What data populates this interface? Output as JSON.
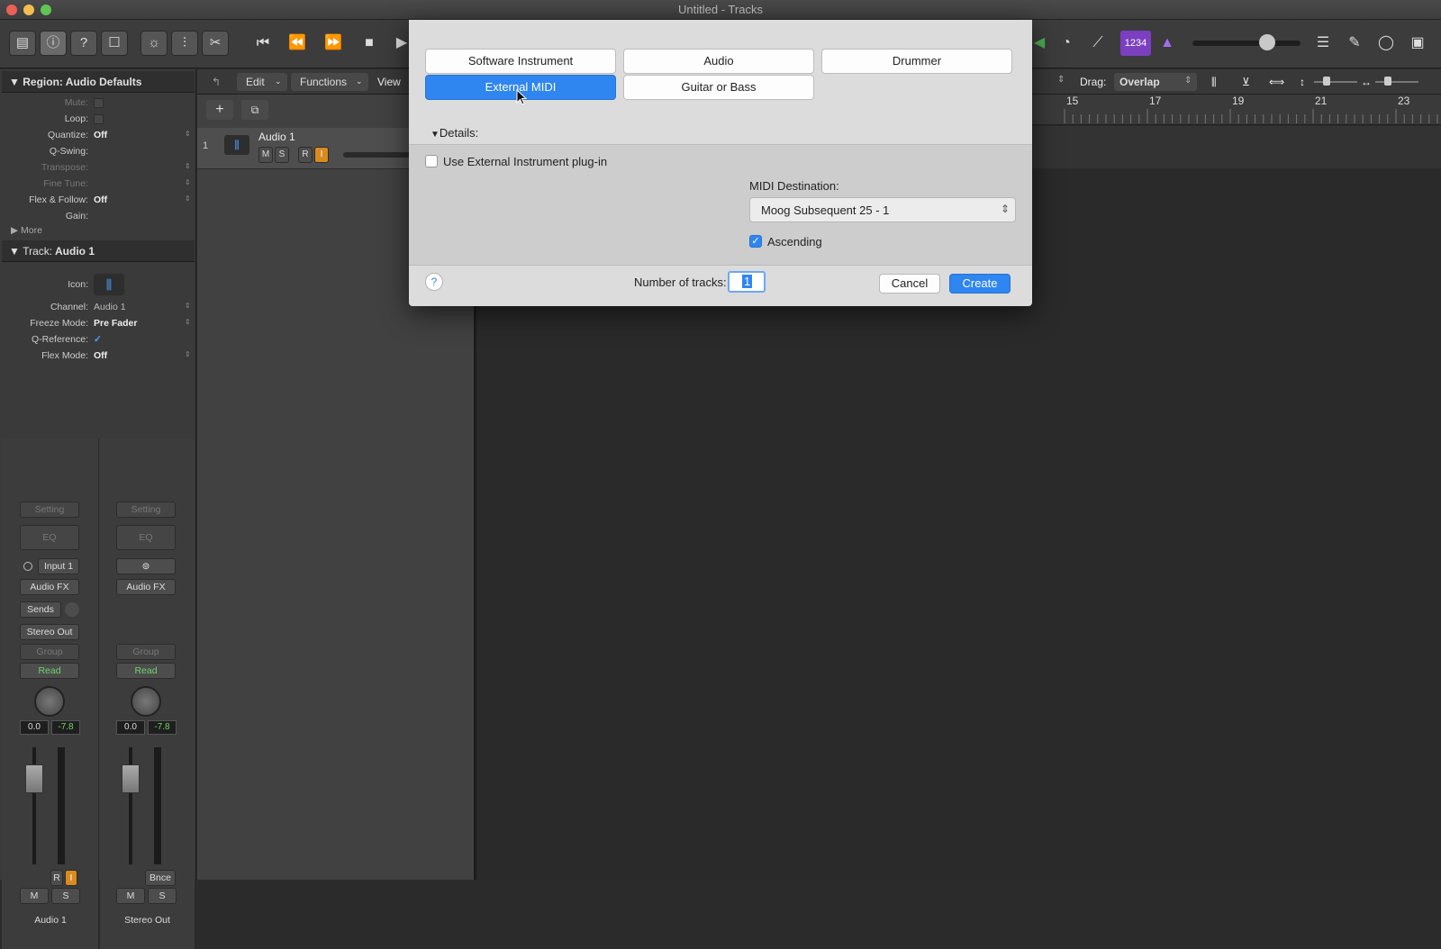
{
  "window": {
    "title": "Untitled - Tracks"
  },
  "region_inspector": {
    "header": "Region: Audio Defaults",
    "rows": [
      {
        "label": "Mute:",
        "value": ""
      },
      {
        "label": "Loop:",
        "value": ""
      },
      {
        "label": "Quantize:",
        "value": "Off"
      },
      {
        "label": "Q-Swing:",
        "value": ""
      },
      {
        "label": "Transpose:",
        "value": ""
      },
      {
        "label": "Fine Tune:",
        "value": ""
      },
      {
        "label": "Flex & Follow:",
        "value": "Off"
      },
      {
        "label": "Gain:",
        "value": ""
      }
    ],
    "more": "More"
  },
  "track_inspector": {
    "header": "Track:",
    "header_name": "Audio 1",
    "icon_label": "Icon:",
    "rows": [
      {
        "label": "Channel:",
        "value": "Audio 1"
      },
      {
        "label": "Freeze Mode:",
        "value": "Pre Fader"
      },
      {
        "label": "Q-Reference:",
        "value": "✓"
      },
      {
        "label": "Flex Mode:",
        "value": "Off"
      }
    ]
  },
  "channel_strips": [
    {
      "setting": "Setting",
      "eq": "EQ",
      "input": "Input 1",
      "audio_fx": "Audio FX",
      "sends": "Sends",
      "output": "Stereo Out",
      "group": "Group",
      "automation": "Read",
      "volume": "0.0",
      "peak": "-7.8",
      "rec": "R",
      "input_mon": "I",
      "mute": "M",
      "solo": "S",
      "name": "Audio 1"
    },
    {
      "setting": "Setting",
      "eq": "EQ",
      "audio_fx": "Audio FX",
      "group": "Group",
      "automation": "Read",
      "volume": "0.0",
      "peak": "-7.8",
      "bounce": "Bnce",
      "mute": "M",
      "solo": "S",
      "name": "Stereo Out"
    }
  ],
  "tracks_menu": {
    "edit": "Edit",
    "functions": "Functions",
    "view": "View"
  },
  "drag": {
    "label": "Drag:",
    "value": "Overlap"
  },
  "ruler": {
    "marks": [
      "15",
      "17",
      "19",
      "21",
      "23"
    ]
  },
  "track_list": [
    {
      "number": "1",
      "name": "Audio 1",
      "mute": "M",
      "solo": "S",
      "rec": "R",
      "input": "I"
    }
  ],
  "lcd": {
    "count_in": "1234"
  },
  "dialog": {
    "types": [
      {
        "label": "Software Instrument",
        "selected": false
      },
      {
        "label": "Audio",
        "selected": false
      },
      {
        "label": "Drummer",
        "selected": false
      },
      {
        "label": "External MIDI",
        "selected": true
      },
      {
        "label": "Guitar or Bass",
        "selected": false
      }
    ],
    "details_label": "Details:",
    "use_plugin_label": "Use External Instrument plug-in",
    "midi_dest_label": "MIDI Destination:",
    "midi_dest_value": "Moog Subsequent 25 - 1",
    "ascending_label": "Ascending",
    "ascending_checked": true,
    "num_tracks_label": "Number of tracks:",
    "num_tracks_value": "1",
    "cancel": "Cancel",
    "create": "Create",
    "help": "?"
  },
  "colors": {
    "accent": "#2f86f0",
    "record_orange": "#d98b1f",
    "read_green": "#6fd36f",
    "lcd_purple": "#7b3fbf"
  }
}
